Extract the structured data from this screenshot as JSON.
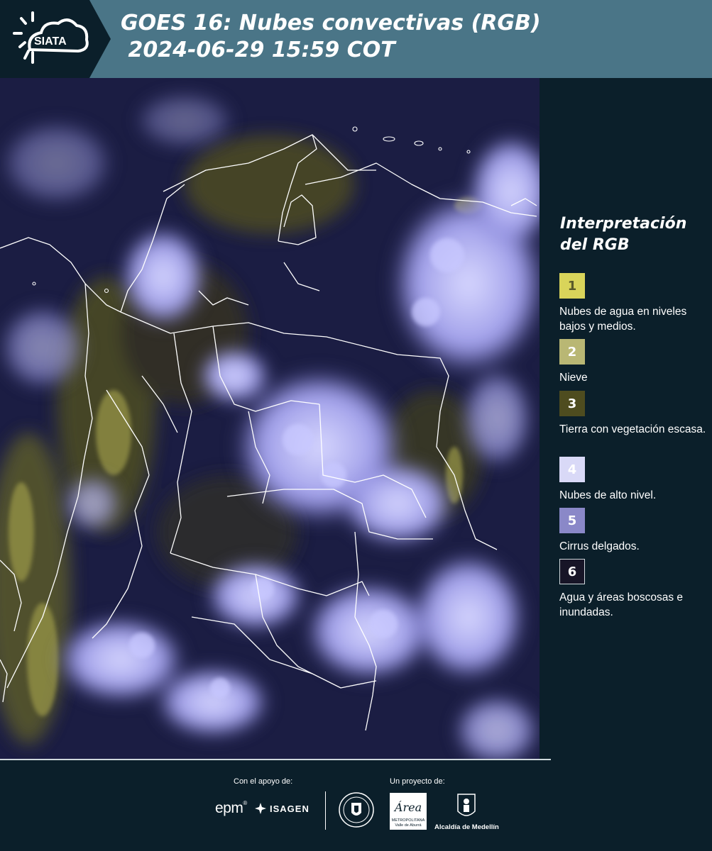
{
  "header": {
    "logo_text": "SIATA",
    "title_line1": "GOES 16: Nubes convectivas (RGB)",
    "title_line2": " 2024-06-29 15:59 COT"
  },
  "map": {
    "description_colors": {
      "background": "#1c1f47",
      "vegetation": "#4a4a1e",
      "cloud": "#a6a6f2",
      "border": "#ffffff"
    }
  },
  "legend": {
    "title": "Interpretación del RGB",
    "items": [
      {
        "number": "1",
        "label": "Nubes de agua en niveles bajos y medios.",
        "color": "#d9d45a",
        "text_color": "#5a5a2a"
      },
      {
        "number": "2",
        "label": "Nieve",
        "color": "#b9b774",
        "text_color": "#ffffff"
      },
      {
        "number": "3",
        "label": "Tierra con vegetación escasa.",
        "color": "#4e4c1f",
        "text_color": "#ffffff"
      },
      {
        "number": "4",
        "label": "Nubes de alto nivel.",
        "color": "#d9d9f7",
        "text_color": "#ffffff"
      },
      {
        "number": "5",
        "label": "Cirrus delgados.",
        "color": "#8a88c8",
        "text_color": "#ffffff"
      },
      {
        "number": "6",
        "label": "Agua y áreas boscosas e inundadas.",
        "color": "#171527",
        "text_color": "#ffffff"
      }
    ]
  },
  "footer": {
    "support_label": "Con el apoyo de:",
    "project_label": "Un proyecto de:",
    "epm": "epm",
    "isagen": "ISAGEN",
    "amva_text": "Área",
    "amva_sub1": "METROPOLITANA",
    "amva_sub2": "Valle de Aburrá",
    "alcaldia": "Alcaldía de Medellín"
  }
}
